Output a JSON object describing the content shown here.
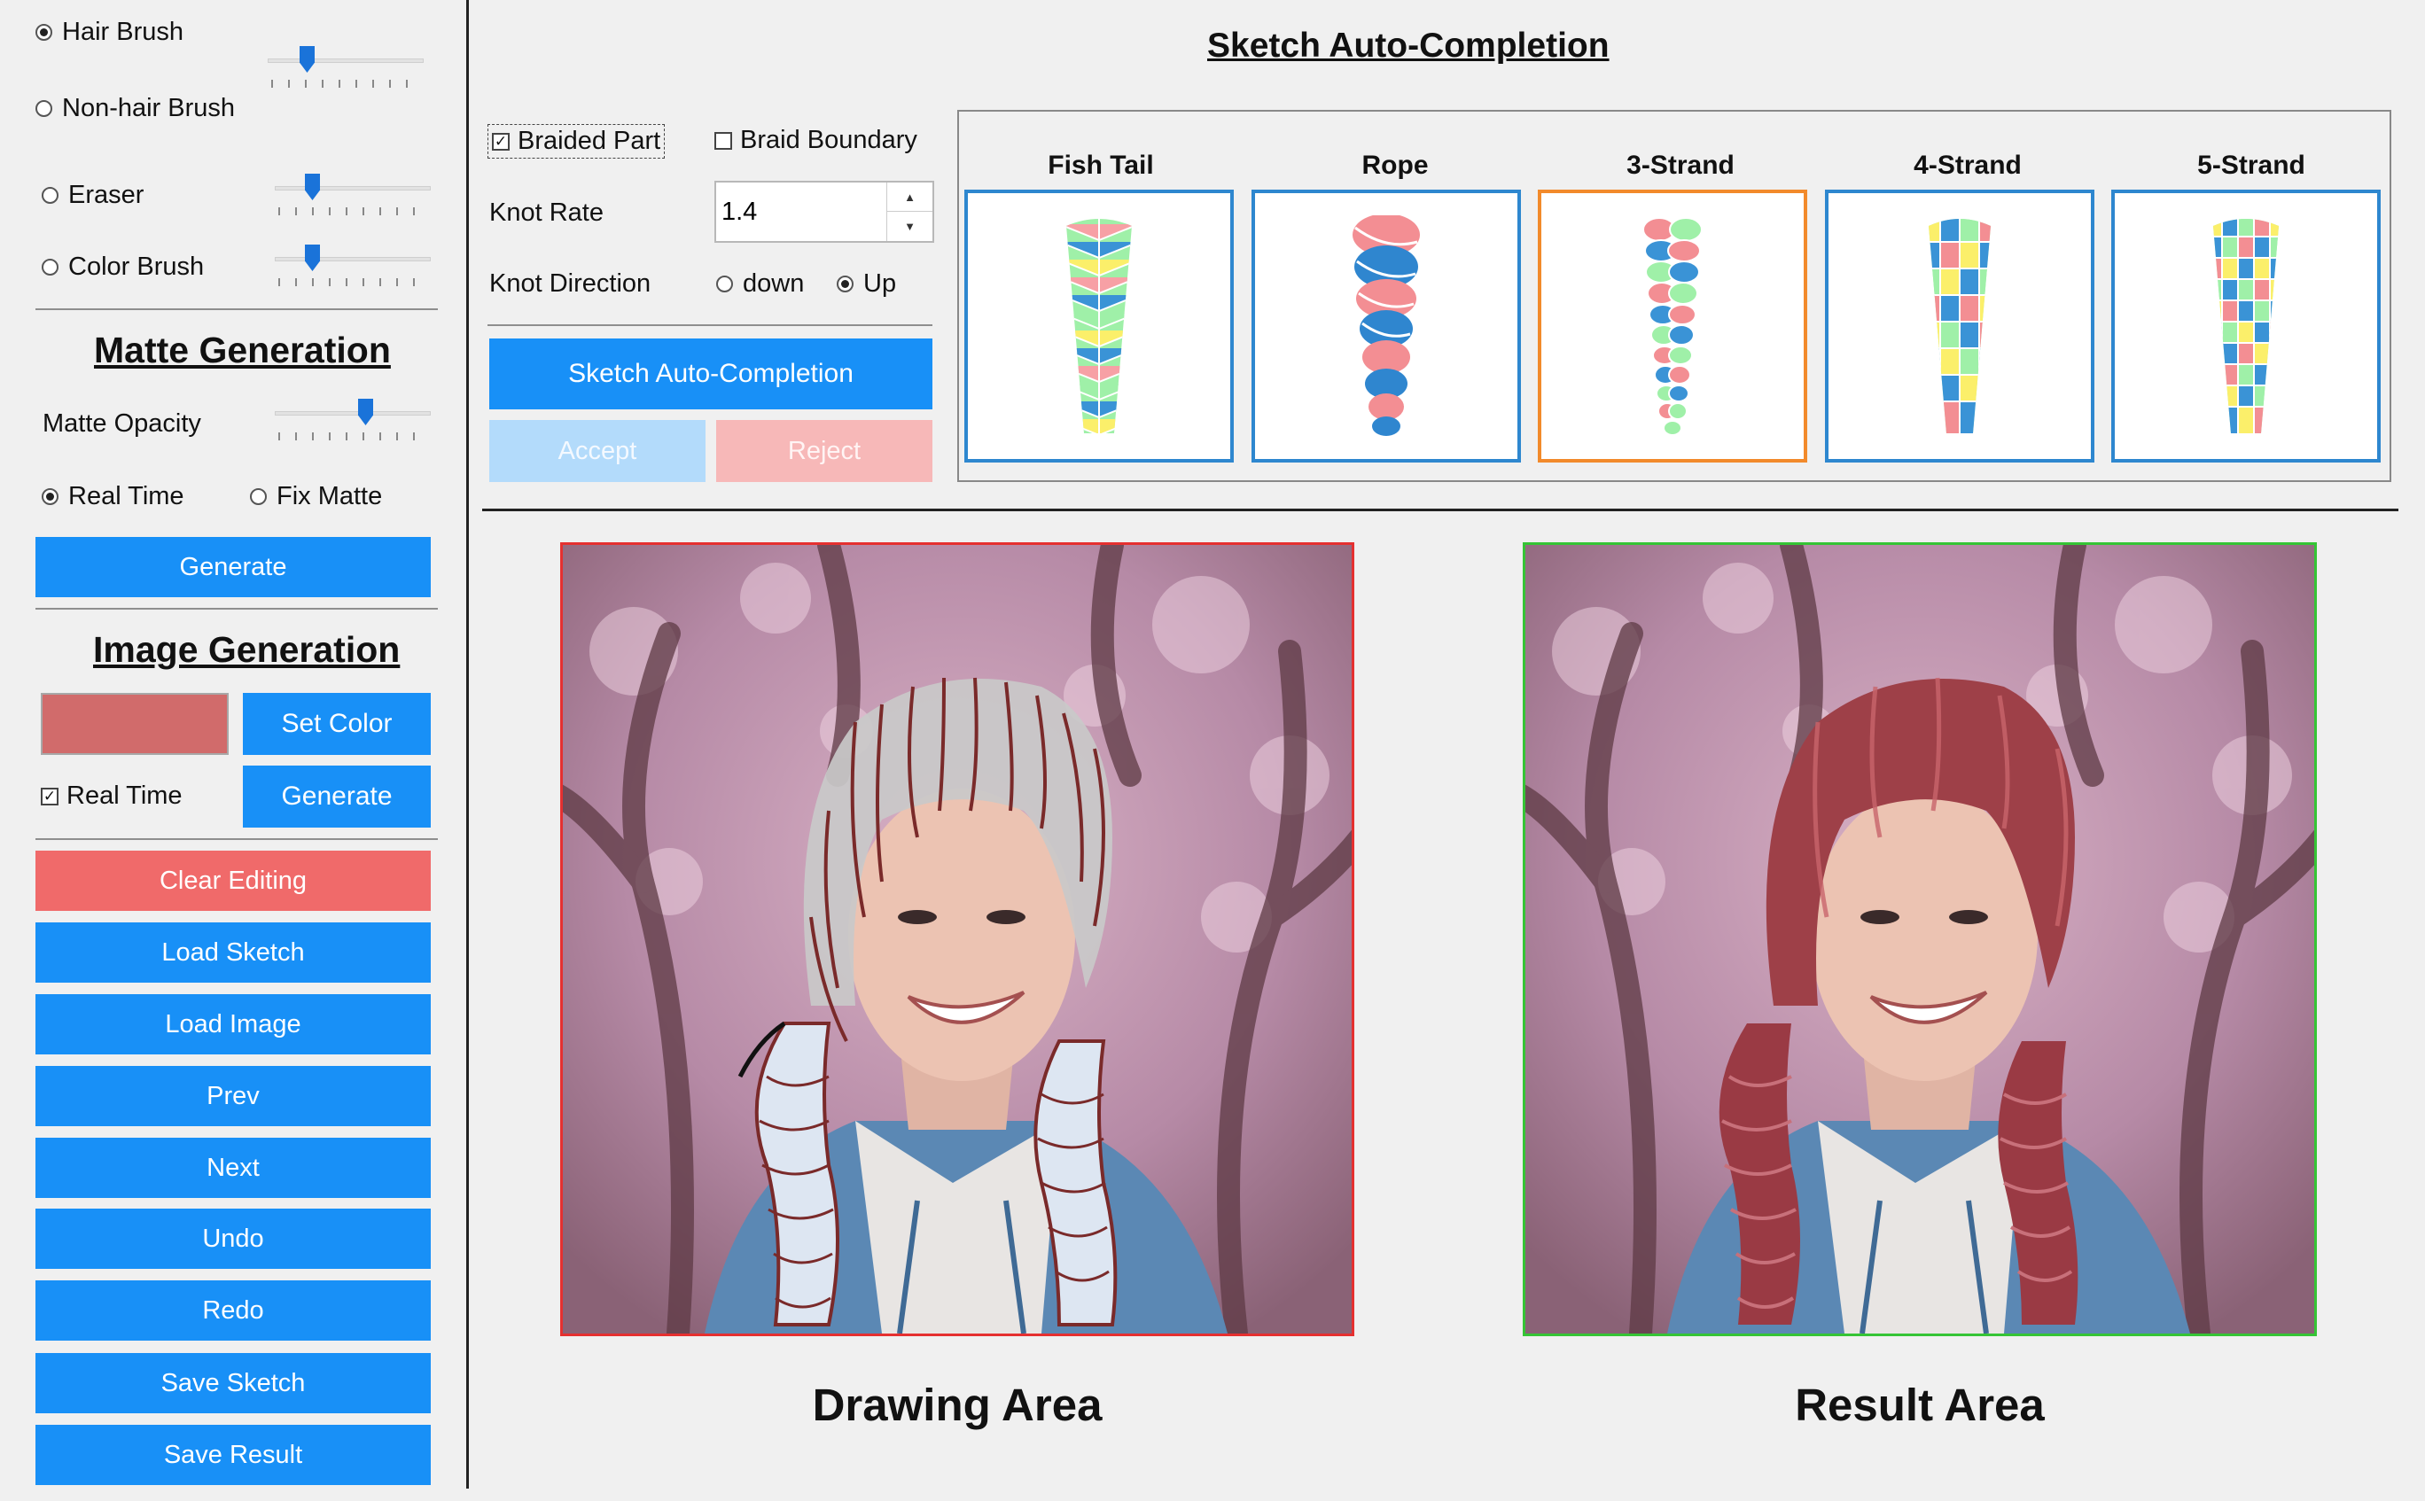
{
  "brush_panel": {
    "hair_brush": "Hair Brush",
    "non_hair_brush": "Non-hair Brush",
    "eraser": "Eraser",
    "color_brush": "Color Brush"
  },
  "matte": {
    "title": "Matte Generation",
    "opacity_label": "Matte Opacity",
    "real_time": "Real Time",
    "fix_matte": "Fix Matte",
    "generate": "Generate"
  },
  "image_gen": {
    "title": "Image Generation",
    "swatch_color": "#d16b6b",
    "set_color": "Set Color",
    "real_time": "Real Time",
    "generate": "Generate"
  },
  "actions": {
    "clear": "Clear Editing",
    "load_sketch": "Load Sketch",
    "load_image": "Load Image",
    "prev": "Prev",
    "next": "Next",
    "undo": "Undo",
    "redo": "Redo",
    "save_sketch": "Save Sketch",
    "save_result": "Save Result"
  },
  "braid": {
    "section_title": "Sketch Auto-Completion",
    "braided_part": "Braided Part",
    "braid_boundary": "Braid Boundary",
    "knot_rate_label": "Knot Rate",
    "knot_rate_value": "1.4",
    "knot_direction_label": "Knot Direction",
    "down": "down",
    "up": "Up",
    "auto_complete": "Sketch Auto-Completion",
    "accept": "Accept",
    "reject": "Reject",
    "styles": [
      "Fish Tail",
      "Rope",
      "3-Strand",
      "4-Strand",
      "5-Strand"
    ]
  },
  "areas": {
    "drawing": "Drawing Area",
    "result": "Result Area"
  },
  "colors": {
    "primary_button": "#1890f7",
    "danger_button": "#f06a6a",
    "selected_style_border": "#f28a2b",
    "style_border": "#2e87cf",
    "drawing_frame": "#e53030",
    "result_frame": "#35c435"
  }
}
